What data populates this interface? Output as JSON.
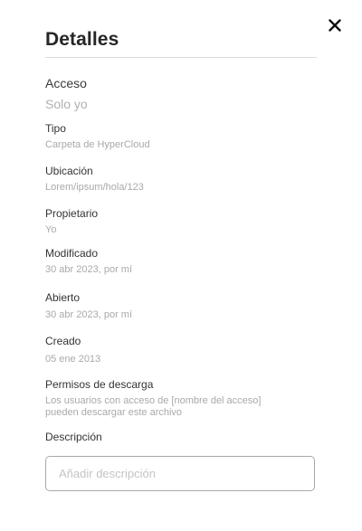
{
  "header": {
    "title": "Detalles",
    "close_icon": "close-icon"
  },
  "fields": {
    "access": {
      "label": "Acceso",
      "value": "Solo yo"
    },
    "type": {
      "label": "Tipo",
      "value": "Carpeta de HyperCloud"
    },
    "location": {
      "label": "Ubicación",
      "value": "Lorem/ipsum/hola/123"
    },
    "owner": {
      "label": "Propietario",
      "value": "Yo"
    },
    "modified": {
      "label": "Modificado",
      "value": "30 abr 2023, por mí"
    },
    "opened": {
      "label": "Abierto",
      "value": "30 abr 2023, por mí"
    },
    "created": {
      "label": "Creado",
      "value": "05 ene 2013"
    },
    "download_permissions": {
      "label": "Permisos de descarga",
      "value_line1": "Los usuarios con acceso de [nombre del acceso]",
      "value_line2": "pueden descargar este archivo"
    },
    "description": {
      "label": "Descripción",
      "placeholder": "Añadir descripción",
      "value": ""
    }
  },
  "colors": {
    "label_text": "#333333",
    "value_text": "#a9a9a9",
    "divider": "#dcdcdc",
    "input_border": "#a8a8a8"
  }
}
